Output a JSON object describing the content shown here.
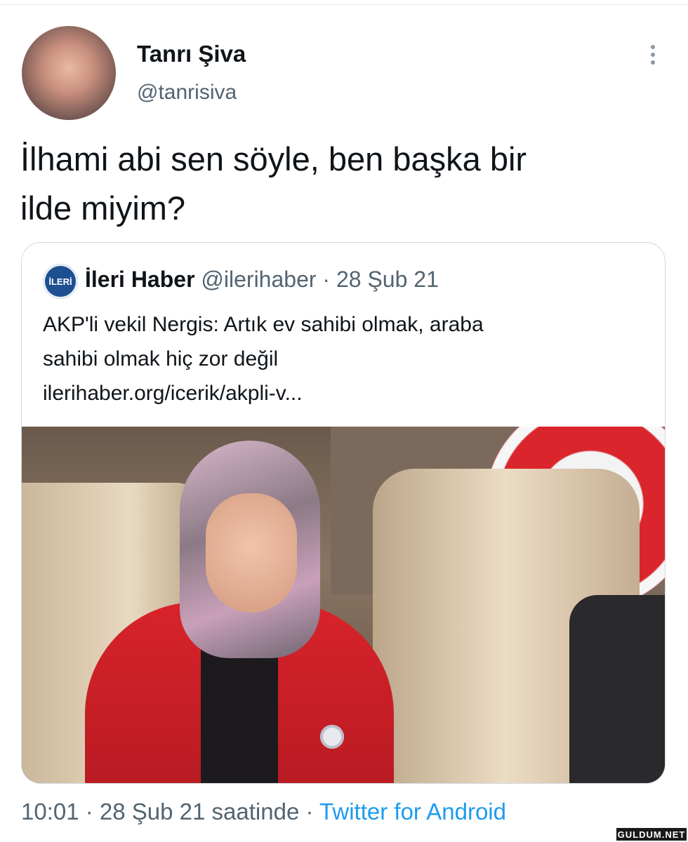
{
  "tweet": {
    "author": {
      "name": "Tanrı Şiva",
      "handle": "@tanrisiva"
    },
    "text": "İlhami abi sen söyle, ben başka bir\nilde miyim?",
    "timestamp": "10:01 · 28 Şub 21 saatinde",
    "separator": " · ",
    "source": "Twitter for Android"
  },
  "quoted": {
    "author": {
      "name": "İleri Haber",
      "handle": "@ilerihaber",
      "avatar_text": "İLERİ"
    },
    "date_meta": " · 28 Şub 21",
    "text": "AKP'li vekil Nergis: Artık ev sahibi olmak, araba\nsahibi olmak hiç zor değil\nilerihaber.org/icerik/akpli-v..."
  },
  "icons": {
    "more": "more-vertical-icon"
  },
  "watermark": "GULDUM.NET",
  "colors": {
    "accent": "#1d9bf0",
    "secondary_text": "#536471",
    "border": "#cfd9de"
  }
}
